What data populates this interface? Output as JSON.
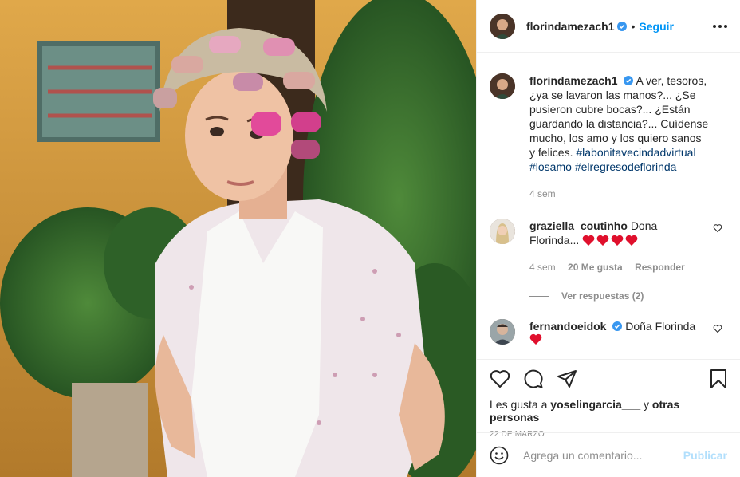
{
  "post": {
    "author": "florindamezach1",
    "follow_label": "Seguir",
    "dot": "•",
    "caption": {
      "text": "A ver, tesoros, ¿ya se lavaron las manos?... ¿Se pusieron cubre bocas?... ¿Están guardando la distancia?... Cuídense mucho, los amo y los quiero sanos y felices.",
      "hashtags": [
        "#labonitavecindadvirtual",
        "#losamo",
        "#elregresodeflorinda"
      ],
      "time": "4 sem"
    },
    "comments": [
      {
        "user": "graziella_coutinho",
        "text": "Dona Florinda...",
        "emoji_hearts": 4,
        "time": "4 sem",
        "likes": "20 Me gusta",
        "reply_label": "Responder",
        "view_replies": "Ver respuestas (2)"
      },
      {
        "user": "fernandoeidok",
        "verified": true,
        "text": "Doña Florinda",
        "emoji_hearts": 1
      }
    ],
    "likes_line": {
      "prefix": "Les gusta a",
      "user": "yoselingarcia___",
      "connector": "y",
      "others": "otras personas"
    },
    "date": "22 DE MARZO",
    "comment_input": {
      "placeholder": "Agrega un comentario...",
      "publish_label": "Publicar"
    }
  },
  "colors": {
    "accent": "#0095f6",
    "publish_disabled": "#b2dffc",
    "hashtag": "#00376b",
    "muted": "#8e8e8e",
    "heart_emoji": "#e0102d"
  },
  "icons": [
    "verified-badge-icon",
    "more-options-icon",
    "heart-icon",
    "comment-icon",
    "share-icon",
    "save-bookmark-icon",
    "emoji-icon"
  ]
}
